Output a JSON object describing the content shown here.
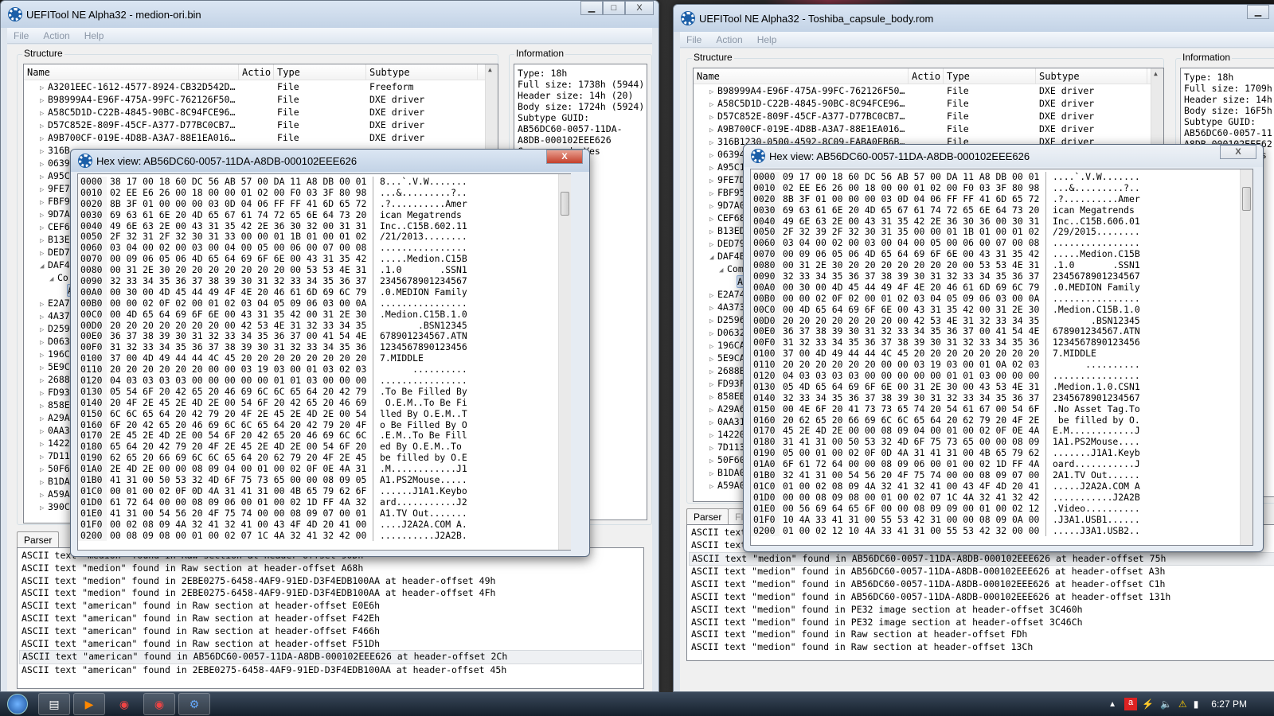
{
  "left_window": {
    "title": "UEFITool NE Alpha32 - medion-ori.bin",
    "menu": [
      "File",
      "Action",
      "Help"
    ],
    "structure_label": "Structure",
    "information_label": "Information",
    "columns": [
      "Name",
      "Actio",
      "Type",
      "Subtype"
    ],
    "tree": [
      {
        "name": "A3201EEC-1612-4577-8924-CB32D542D…",
        "type": "File",
        "subtype": "Freeform",
        "exp": "▷",
        "lvl": 0
      },
      {
        "name": "B98999A4-E96F-475A-99FC-762126F50…",
        "type": "File",
        "subtype": "DXE driver",
        "exp": "▷",
        "lvl": 0
      },
      {
        "name": "A58C5D1D-C22B-4845-90BC-8C94FCE96…",
        "type": "File",
        "subtype": "DXE driver",
        "exp": "▷",
        "lvl": 0
      },
      {
        "name": "D57C852E-809F-45CF-A377-D77BC0CB7…",
        "type": "File",
        "subtype": "DXE driver",
        "exp": "▷",
        "lvl": 0
      },
      {
        "name": "A9B700CF-019E-4D8B-A3A7-88E1EA016…",
        "type": "File",
        "subtype": "DXE driver",
        "exp": "▷",
        "lvl": 0
      },
      {
        "name": "316B",
        "exp": "▷",
        "lvl": 0
      },
      {
        "name": "0639",
        "exp": "▷",
        "lvl": 0
      },
      {
        "name": "A95C",
        "exp": "▷",
        "lvl": 0
      },
      {
        "name": "9FE7",
        "exp": "▷",
        "lvl": 0
      },
      {
        "name": "FBF9",
        "exp": "▷",
        "lvl": 0
      },
      {
        "name": "9D7A",
        "exp": "▷",
        "lvl": 0
      },
      {
        "name": "CEF6",
        "exp": "▷",
        "lvl": 0
      },
      {
        "name": "B13E",
        "exp": "▷",
        "lvl": 0
      },
      {
        "name": "DED7",
        "exp": "▷",
        "lvl": 0
      },
      {
        "name": "DAF4",
        "exp": "◢",
        "lvl": 0
      },
      {
        "name": "Co",
        "exp": "◢",
        "lvl": 1
      },
      {
        "name": "A",
        "exp": "",
        "lvl": 2,
        "selected": true
      },
      {
        "name": "E2A7",
        "exp": "▷",
        "lvl": 0
      },
      {
        "name": "4A37",
        "exp": "▷",
        "lvl": 0
      },
      {
        "name": "D259",
        "exp": "▷",
        "lvl": 0
      },
      {
        "name": "D063",
        "exp": "▷",
        "lvl": 0
      },
      {
        "name": "196C",
        "exp": "▷",
        "lvl": 0
      },
      {
        "name": "5E9C",
        "exp": "▷",
        "lvl": 0
      },
      {
        "name": "2688",
        "exp": "▷",
        "lvl": 0
      },
      {
        "name": "FD93",
        "exp": "▷",
        "lvl": 0
      },
      {
        "name": "858E",
        "exp": "▷",
        "lvl": 0
      },
      {
        "name": "A29A",
        "exp": "▷",
        "lvl": 0
      },
      {
        "name": "0AA3",
        "exp": "▷",
        "lvl": 0
      },
      {
        "name": "1422",
        "exp": "▷",
        "lvl": 0
      },
      {
        "name": "7D11",
        "exp": "▷",
        "lvl": 0
      },
      {
        "name": "50F6",
        "exp": "▷",
        "lvl": 0
      },
      {
        "name": "B1DA",
        "exp": "▷",
        "lvl": 0
      },
      {
        "name": "A59A",
        "exp": "▷",
        "lvl": 0
      },
      {
        "name": "390C",
        "exp": "▷",
        "lvl": 0
      }
    ],
    "info": "Type: 18h\nFull size: 1738h (5944)\nHeader size: 14h (20)\nBody size: 1724h (5924)\nSubtype GUID:\nAB56DC60-0057-11DA-\nA8DB-000102EEE626\nCompressed: Yes",
    "parser_tab": "Parser",
    "log": [
      "ASCII text \"medion\" found in Raw section at header-offset 90Dh",
      "ASCII text \"medion\" found in Raw section at header-offset A68h",
      "ASCII text \"medion\" found in 2EBE0275-6458-4AF9-91ED-D3F4EDB100AA at header-offset 49h",
      "ASCII text \"medion\" found in 2EBE0275-6458-4AF9-91ED-D3F4EDB100AA at header-offset 4Fh",
      "ASCII text \"american\" found in Raw section at header-offset E0E6h",
      "ASCII text \"american\" found in Raw section at header-offset F42Eh",
      "ASCII text \"american\" found in Raw section at header-offset F466h",
      "ASCII text \"american\" found in Raw section at header-offset F51Dh",
      "ASCII text \"american\" found in AB56DC60-0057-11DA-A8DB-000102EEE626 at header-offset 2Ch",
      "ASCII text \"american\" found in 2EBE0275-6458-4AF9-91ED-D3F4EDB100AA at header-offset 45h"
    ],
    "log_highlight": 8,
    "hex": {
      "title": "Hex view: AB56DC60-0057-11DA-A8DB-000102EEE626",
      "close": "X",
      "rows": [
        [
          "0000",
          "38 17 00 18 60 DC 56 AB 57 00 DA 11 A8 DB 00 01",
          "8...`.V.W......."
        ],
        [
          "0010",
          "02 EE E6 26 00 18 00 00 01 02 00 F0 03 3F 80 98",
          "...&.........?.."
        ],
        [
          "0020",
          "8B 3F 01 00 00 00 03 0D 04 06 FF FF 41 6D 65 72",
          ".?..........Amer"
        ],
        [
          "0030",
          "69 63 61 6E 20 4D 65 67 61 74 72 65 6E 64 73 20",
          "ican Megatrends "
        ],
        [
          "0040",
          "49 6E 63 2E 00 43 31 35 42 2E 36 30 32 00 31 31",
          "Inc..C15B.602.11"
        ],
        [
          "0050",
          "2F 32 31 2F 32 30 31 33 00 00 01 1B 01 00 01 02",
          "/21/2013........"
        ],
        [
          "0060",
          "03 04 00 02 00 03 00 04 00 05 00 06 00 07 00 08",
          "................"
        ],
        [
          "0070",
          "00 09 06 05 06 4D 65 64 69 6F 6E 00 43 31 35 42",
          ".....Medion.C15B"
        ],
        [
          "0080",
          "00 31 2E 30 20 20 20 20 20 20 20 00 53 53 4E 31",
          ".1.0       .SSN1"
        ],
        [
          "0090",
          "32 33 34 35 36 37 38 39 30 31 32 33 34 35 36 37",
          "2345678901234567"
        ],
        [
          "00A0",
          "00 30 00 4D 45 44 49 4F 4E 20 46 61 6D 69 6C 79",
          ".0.MEDION Family"
        ],
        [
          "00B0",
          "00 00 02 0F 02 00 01 02 03 04 05 09 06 03 00 0A",
          "................"
        ],
        [
          "00C0",
          "00 4D 65 64 69 6F 6E 00 43 31 35 42 00 31 2E 30",
          ".Medion.C15B.1.0"
        ],
        [
          "00D0",
          "20 20 20 20 20 20 20 00 42 53 4E 31 32 33 34 35",
          "       .BSN12345"
        ],
        [
          "00E0",
          "36 37 38 39 30 31 32 33 34 35 36 37 00 41 54 4E",
          "678901234567.ATN"
        ],
        [
          "00F0",
          "31 32 33 34 35 36 37 38 39 30 31 32 33 34 35 36",
          "1234567890123456"
        ],
        [
          "0100",
          "37 00 4D 49 44 44 4C 45 20 20 20 20 20 20 20 20",
          "7.MIDDLE        "
        ],
        [
          "0110",
          "20 20 20 20 20 20 00 00 03 19 03 00 01 03 02 03",
          "      .........."
        ],
        [
          "0120",
          "04 03 03 03 03 00 00 00 00 00 01 01 03 00 00 00",
          "................"
        ],
        [
          "0130",
          "05 54 6F 20 42 65 20 46 69 6C 6C 65 64 20 42 79",
          ".To Be Filled By"
        ],
        [
          "0140",
          "20 4F 2E 45 2E 4D 2E 00 54 6F 20 42 65 20 46 69",
          " O.E.M..To Be Fi"
        ],
        [
          "0150",
          "6C 6C 65 64 20 42 79 20 4F 2E 45 2E 4D 2E 00 54",
          "lled By O.E.M..T"
        ],
        [
          "0160",
          "6F 20 42 65 20 46 69 6C 6C 65 64 20 42 79 20 4F",
          "o Be Filled By O"
        ],
        [
          "0170",
          "2E 45 2E 4D 2E 00 54 6F 20 42 65 20 46 69 6C 6C",
          ".E.M..To Be Fill"
        ],
        [
          "0180",
          "65 64 20 42 79 20 4F 2E 45 2E 4D 2E 00 54 6F 20",
          "ed By O.E.M..To "
        ],
        [
          "0190",
          "62 65 20 66 69 6C 6C 65 64 20 62 79 20 4F 2E 45",
          "be filled by O.E"
        ],
        [
          "01A0",
          "2E 4D 2E 00 00 08 09 04 00 01 00 02 0F 0E 4A 31",
          ".M............J1"
        ],
        [
          "01B0",
          "41 31 00 50 53 32 4D 6F 75 73 65 00 00 08 09 05",
          "A1.PS2Mouse....."
        ],
        [
          "01C0",
          "00 01 00 02 0F 0D 4A 31 41 31 00 4B 65 79 62 6F",
          "......J1A1.Keybo"
        ],
        [
          "01D0",
          "61 72 64 00 00 08 09 06 00 01 00 02 1D FF 4A 32",
          "ard...........J2"
        ],
        [
          "01E0",
          "41 31 00 54 56 20 4F 75 74 00 00 08 09 07 00 01",
          "A1.TV Out......."
        ],
        [
          "01F0",
          "00 02 08 09 4A 32 41 32 41 00 43 4F 4D 20 41 00",
          "....J2A2A.COM A."
        ],
        [
          "0200",
          "00 08 09 08 00 01 00 02 07 1C 4A 32 41 32 42 00",
          "..........J2A2B."
        ]
      ]
    }
  },
  "right_window": {
    "title": "UEFITool NE Alpha32 - Toshiba_capsule_body.rom",
    "menu": [
      "File",
      "Action",
      "Help"
    ],
    "structure_label": "Structure",
    "information_label": "Information",
    "columns": [
      "Name",
      "Actio",
      "Type",
      "Subtype"
    ],
    "tree": [
      {
        "name": "B98999A4-E96F-475A-99FC-762126F50…",
        "type": "File",
        "subtype": "DXE driver",
        "exp": "▷",
        "lvl": 0
      },
      {
        "name": "A58C5D1D-C22B-4845-90BC-8C94FCE96…",
        "type": "File",
        "subtype": "DXE driver",
        "exp": "▷",
        "lvl": 0
      },
      {
        "name": "D57C852E-809F-45CF-A377-D77BC0CB7…",
        "type": "File",
        "subtype": "DXE driver",
        "exp": "▷",
        "lvl": 0
      },
      {
        "name": "A9B700CF-019E-4D8B-A3A7-88E1EA016…",
        "type": "File",
        "subtype": "DXE driver",
        "exp": "▷",
        "lvl": 0
      },
      {
        "name": "316B1230-0500-4592-8C09-EABA0FB6B…",
        "type": "File",
        "subtype": "DXE driver",
        "exp": "▷",
        "lvl": 0
      },
      {
        "name": "06394",
        "exp": "▷",
        "lvl": 0
      },
      {
        "name": "A95C1",
        "exp": "▷",
        "lvl": 0
      },
      {
        "name": "9FE7D",
        "exp": "▷",
        "lvl": 0
      },
      {
        "name": "FBF95",
        "exp": "▷",
        "lvl": 0
      },
      {
        "name": "9D7A0",
        "exp": "▷",
        "lvl": 0
      },
      {
        "name": "CEF68",
        "exp": "▷",
        "lvl": 0
      },
      {
        "name": "B13ED",
        "exp": "▷",
        "lvl": 0
      },
      {
        "name": "DED79",
        "exp": "▷",
        "lvl": 0
      },
      {
        "name": "DAF4B",
        "exp": "◢",
        "lvl": 0
      },
      {
        "name": "Comp",
        "exp": "◢",
        "lvl": 1
      },
      {
        "name": "AB5",
        "exp": "",
        "lvl": 2,
        "selected": true
      },
      {
        "name": "E2A74",
        "exp": "▷",
        "lvl": 0
      },
      {
        "name": "4A373",
        "exp": "▷",
        "lvl": 0
      },
      {
        "name": "D2596",
        "exp": "▷",
        "lvl": 0
      },
      {
        "name": "D0632",
        "exp": "▷",
        "lvl": 0
      },
      {
        "name": "196CA",
        "exp": "▷",
        "lvl": 0
      },
      {
        "name": "5E9CA",
        "exp": "▷",
        "lvl": 0
      },
      {
        "name": "2688B",
        "exp": "▷",
        "lvl": 0
      },
      {
        "name": "FD93F",
        "exp": "▷",
        "lvl": 0
      },
      {
        "name": "858EB",
        "exp": "▷",
        "lvl": 0
      },
      {
        "name": "A29A6",
        "exp": "▷",
        "lvl": 0
      },
      {
        "name": "0AA31",
        "exp": "▷",
        "lvl": 0
      },
      {
        "name": "14220",
        "exp": "▷",
        "lvl": 0
      },
      {
        "name": "7D113",
        "exp": "▷",
        "lvl": 0
      },
      {
        "name": "50F60",
        "exp": "▷",
        "lvl": 0
      },
      {
        "name": "B1DA0",
        "exp": "▷",
        "lvl": 0
      },
      {
        "name": "A59A0",
        "exp": "▷",
        "lvl": 0
      }
    ],
    "info": "Type: 18h\nFull size: 1709h\nHeader size: 14h\nBody size: 16F5h\nSubtype GUID:\nAB56DC60-0057-11\nA8DB-000102EEE62\nCompressed: Yes",
    "parser_tab": "Parser",
    "tab2": "FI",
    "log": [
      "ASCII text",
      "ASCII text",
      "ASCII text \"medion\" found in AB56DC60-0057-11DA-A8DB-000102EEE626 at header-offset 75h",
      "ASCII text \"medion\" found in AB56DC60-0057-11DA-A8DB-000102EEE626 at header-offset A3h",
      "ASCII text \"medion\" found in AB56DC60-0057-11DA-A8DB-000102EEE626 at header-offset C1h",
      "ASCII text \"medion\" found in AB56DC60-0057-11DA-A8DB-000102EEE626 at header-offset 131h",
      "ASCII text \"medion\" found in PE32 image section at header-offset 3C460h",
      "ASCII text \"medion\" found in PE32 image section at header-offset 3C46Ch",
      "ASCII text \"medion\" found in Raw section at header-offset FDh",
      "ASCII text \"medion\" found in Raw section at header-offset 13Ch"
    ],
    "log_highlight": 2,
    "hex": {
      "title": "Hex view: AB56DC60-0057-11DA-A8DB-000102EEE626",
      "close": "X",
      "rows": [
        [
          "0000",
          "09 17 00 18 60 DC 56 AB 57 00 DA 11 A8 DB 00 01",
          "....`.V.W......."
        ],
        [
          "0010",
          "02 EE E6 26 00 18 00 00 01 02 00 F0 03 3F 80 98",
          "...&.........?.."
        ],
        [
          "0020",
          "8B 3F 01 00 00 00 03 0D 04 06 FF FF 41 6D 65 72",
          ".?..........Amer"
        ],
        [
          "0030",
          "69 63 61 6E 20 4D 65 67 61 74 72 65 6E 64 73 20",
          "ican Megatrends "
        ],
        [
          "0040",
          "49 6E 63 2E 00 43 31 35 42 2E 36 30 36 00 30 31",
          "Inc..C15B.606.01"
        ],
        [
          "0050",
          "2F 32 39 2F 32 30 31 35 00 00 01 1B 01 00 01 02",
          "/29/2015........"
        ],
        [
          "0060",
          "03 04 00 02 00 03 00 04 00 05 00 06 00 07 00 08",
          "................"
        ],
        [
          "0070",
          "00 09 06 05 06 4D 65 64 69 6F 6E 00 43 31 35 42",
          ".....Medion.C15B"
        ],
        [
          "0080",
          "00 31 2E 30 20 20 20 20 20 20 20 00 53 53 4E 31",
          ".1.0       .SSN1"
        ],
        [
          "0090",
          "32 33 34 35 36 37 38 39 30 31 32 33 34 35 36 37",
          "2345678901234567"
        ],
        [
          "00A0",
          "00 30 00 4D 45 44 49 4F 4E 20 46 61 6D 69 6C 79",
          ".0.MEDION Family"
        ],
        [
          "00B0",
          "00 00 02 0F 02 00 01 02 03 04 05 09 06 03 00 0A",
          "................"
        ],
        [
          "00C0",
          "00 4D 65 64 69 6F 6E 00 43 31 35 42 00 31 2E 30",
          ".Medion.C15B.1.0"
        ],
        [
          "00D0",
          "20 20 20 20 20 20 20 00 42 53 4E 31 32 33 34 35",
          "       .BSN12345"
        ],
        [
          "00E0",
          "36 37 38 39 30 31 32 33 34 35 36 37 00 41 54 4E",
          "678901234567.ATN"
        ],
        [
          "00F0",
          "31 32 33 34 35 36 37 38 39 30 31 32 33 34 35 36",
          "1234567890123456"
        ],
        [
          "0100",
          "37 00 4D 49 44 44 4C 45 20 20 20 20 20 20 20 20",
          "7.MIDDLE        "
        ],
        [
          "0110",
          "20 20 20 20 20 20 00 00 03 19 03 00 01 0A 02 03",
          "      .........."
        ],
        [
          "0120",
          "04 03 03 03 03 00 00 00 00 00 01 01 03 00 00 00",
          "................"
        ],
        [
          "0130",
          "05 4D 65 64 69 6F 6E 00 31 2E 30 00 43 53 4E 31",
          ".Medion.1.0.CSN1"
        ],
        [
          "0140",
          "32 33 34 35 36 37 38 39 30 31 32 33 34 35 36 37",
          "2345678901234567"
        ],
        [
          "0150",
          "00 4E 6F 20 41 73 73 65 74 20 54 61 67 00 54 6F",
          ".No Asset Tag.To"
        ],
        [
          "0160",
          "20 62 65 20 66 69 6C 6C 65 64 20 62 79 20 4F 2E",
          " be filled by O."
        ],
        [
          "0170",
          "45 2E 4D 2E 00 00 08 09 04 00 01 00 02 0F 0E 4A",
          "E.M............J"
        ],
        [
          "0180",
          "31 41 31 00 50 53 32 4D 6F 75 73 65 00 00 08 09",
          "1A1.PS2Mouse...."
        ],
        [
          "0190",
          "05 00 01 00 02 0F 0D 4A 31 41 31 00 4B 65 79 62",
          ".......J1A1.Keyb"
        ],
        [
          "01A0",
          "6F 61 72 64 00 00 08 09 06 00 01 00 02 1D FF 4A",
          "oard...........J"
        ],
        [
          "01B0",
          "32 41 31 00 54 56 20 4F 75 74 00 00 08 09 07 00",
          "2A1.TV Out......"
        ],
        [
          "01C0",
          "01 00 02 08 09 4A 32 41 32 41 00 43 4F 4D 20 41",
          ".....J2A2A.COM A"
        ],
        [
          "01D0",
          "00 00 08 09 08 00 01 00 02 07 1C 4A 32 41 32 42",
          "...........J2A2B"
        ],
        [
          "01E0",
          "00 56 69 64 65 6F 00 00 08 09 09 00 01 00 02 12",
          ".Video.........."
        ],
        [
          "01F0",
          "10 4A 33 41 31 00 55 53 42 31 00 00 08 09 0A 00",
          ".J3A1.USB1......"
        ],
        [
          "0200",
          "01 00 02 12 10 4A 33 41 31 00 55 53 42 32 00 00",
          ".....J3A1.USB2.."
        ]
      ]
    }
  },
  "taskbar": {
    "clock": "6:27 PM",
    "start_icon": "windows-start-icon",
    "apps": [
      "file-explorer-icon",
      "media-player-icon",
      "chrome-icon",
      "chrome-icon",
      "uefitool-icon"
    ]
  }
}
